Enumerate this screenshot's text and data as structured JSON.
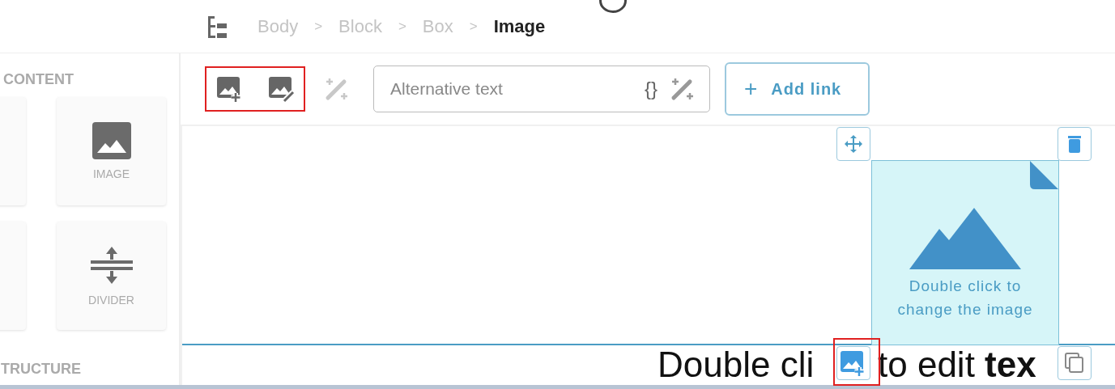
{
  "breadcrumb": [
    {
      "label": "Body",
      "current": false
    },
    {
      "label": "Block",
      "current": false,
      "separator": ">"
    },
    {
      "label": "Box",
      "current": false,
      "separator": ">"
    },
    {
      "label": "Image",
      "current": true,
      "separator": ">"
    }
  ],
  "sidebar": {
    "content_title": "CONTENT",
    "content_items": [
      {
        "kind": "blank"
      },
      {
        "kind": "image",
        "label": "IMAGE"
      },
      {
        "kind": "blank"
      },
      {
        "kind": "divider",
        "label": "DIVIDER"
      }
    ],
    "structure_title": "TRUCTURE"
  },
  "toolbar": {
    "alt_text": {
      "placeholder": "Alternative text"
    },
    "variable_token": "{}",
    "add_link": {
      "icon": "+",
      "label": "Add link"
    }
  },
  "image_block": {
    "hint": "Double click to change the image"
  },
  "text_block": {
    "parts": [
      "Double cli",
      "to edit **tex**"
    ]
  }
}
